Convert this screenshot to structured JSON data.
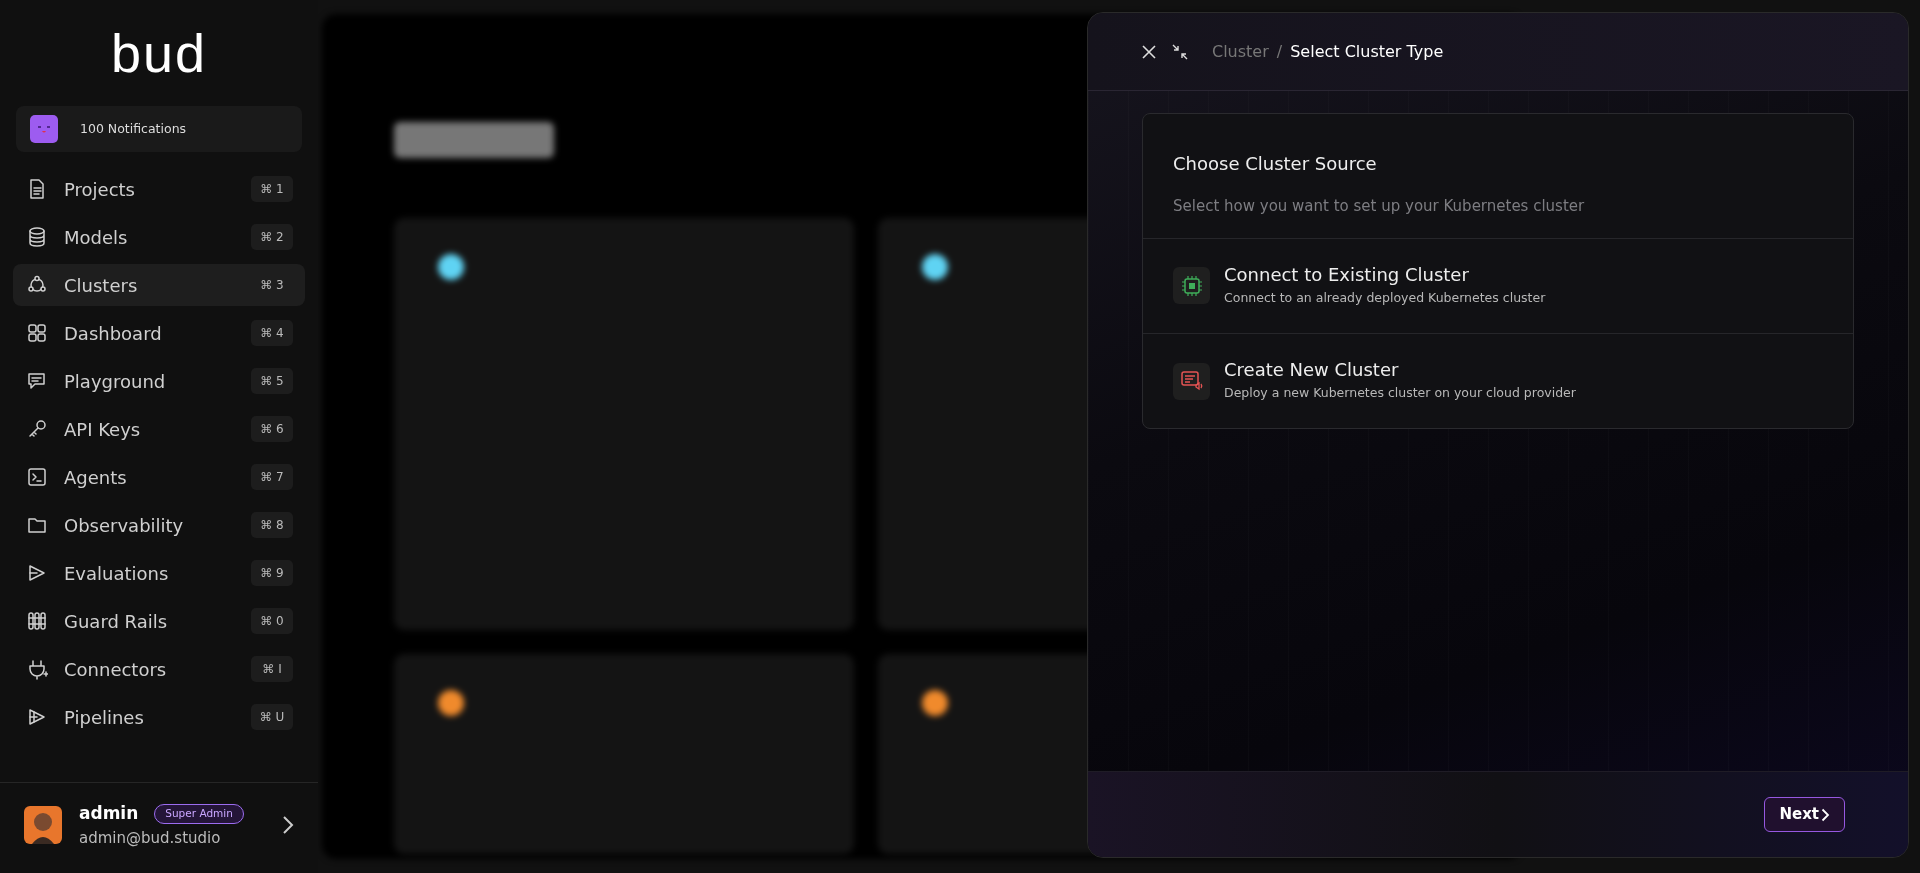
{
  "sidebar": {
    "logo": "bud",
    "notifications": {
      "label": "100 Notifications"
    },
    "items": [
      {
        "label": "Projects",
        "shortcut": "⌘ 1",
        "selected": false
      },
      {
        "label": "Models",
        "shortcut": "⌘ 2",
        "selected": false
      },
      {
        "label": "Clusters",
        "shortcut": "⌘ 3",
        "selected": true
      },
      {
        "label": "Dashboard",
        "shortcut": "⌘ 4",
        "selected": false
      },
      {
        "label": "Playground",
        "shortcut": "⌘ 5",
        "selected": false
      },
      {
        "label": "API Keys",
        "shortcut": "⌘ 6",
        "selected": false
      },
      {
        "label": "Agents",
        "shortcut": "⌘ 7",
        "selected": false
      },
      {
        "label": "Observability",
        "shortcut": "⌘ 8",
        "selected": false
      },
      {
        "label": "Evaluations",
        "shortcut": "⌘ 9",
        "selected": false
      },
      {
        "label": "Guard Rails",
        "shortcut": "⌘ 0",
        "selected": false
      },
      {
        "label": "Connectors",
        "shortcut": "⌘ I",
        "selected": false
      },
      {
        "label": "Pipelines",
        "shortcut": "⌘ U",
        "selected": false
      }
    ],
    "user": {
      "name": "admin",
      "role": "Super Admin",
      "email": "admin@bud.studio"
    }
  },
  "page": {
    "cards": [
      {
        "color": "#5fd3f3"
      },
      {
        "color": "#5fd3f3"
      },
      {
        "color": "#f08a2c"
      },
      {
        "color": "#f08a2c"
      }
    ]
  },
  "drawer": {
    "breadcrumb": [
      "Cluster",
      "Select Cluster Type"
    ],
    "breadcrumb_separator": "/",
    "heading": "Choose Cluster Source",
    "subheading": "Select how you want to set up your Kubernetes cluster",
    "options": [
      {
        "kind": "connect",
        "title": "Connect to Existing Cluster",
        "description": "Connect to an already deployed Kubernetes cluster",
        "selected": false
      },
      {
        "kind": "create",
        "title": "Create New Cluster",
        "description": "Deploy a new Kubernetes cluster on your cloud provider",
        "selected": false
      }
    ],
    "next_button": "Next"
  }
}
